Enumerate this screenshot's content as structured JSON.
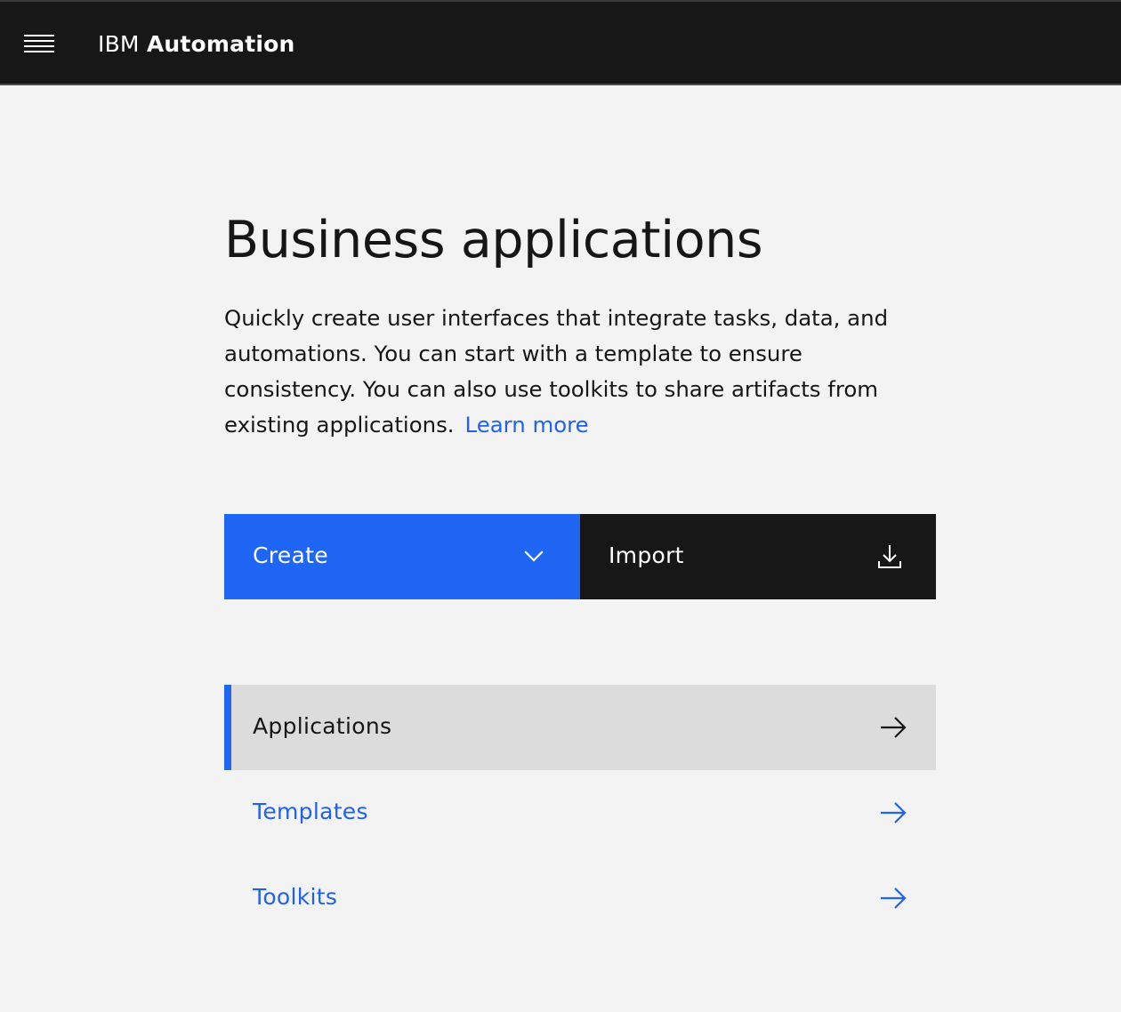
{
  "header": {
    "brand_prefix": "IBM",
    "brand_name": "Automation",
    "menu_icon": "hamburger-menu-icon"
  },
  "page": {
    "title": "Business applications",
    "description": "Quickly create user interfaces that integrate tasks, data, and automations. You can start with a template to ensure consistency. You can also use toolkits to share artifacts from existing applications.",
    "learn_more": "Learn more"
  },
  "actions": {
    "create_label": "Create",
    "create_icon": "chevron-down-icon",
    "import_label": "Import",
    "import_icon": "download-icon"
  },
  "nav": {
    "items": [
      {
        "label": "Applications",
        "icon": "arrow-right-icon",
        "active": true
      },
      {
        "label": "Templates",
        "icon": "arrow-right-icon",
        "active": false
      },
      {
        "label": "Toolkits",
        "icon": "arrow-right-icon",
        "active": false
      }
    ]
  },
  "colors": {
    "accent": "#2066f5",
    "link": "#1f62eb",
    "header_bg": "#171717",
    "page_bg": "#f3f3f3",
    "active_row_bg": "#dcdcdc"
  }
}
